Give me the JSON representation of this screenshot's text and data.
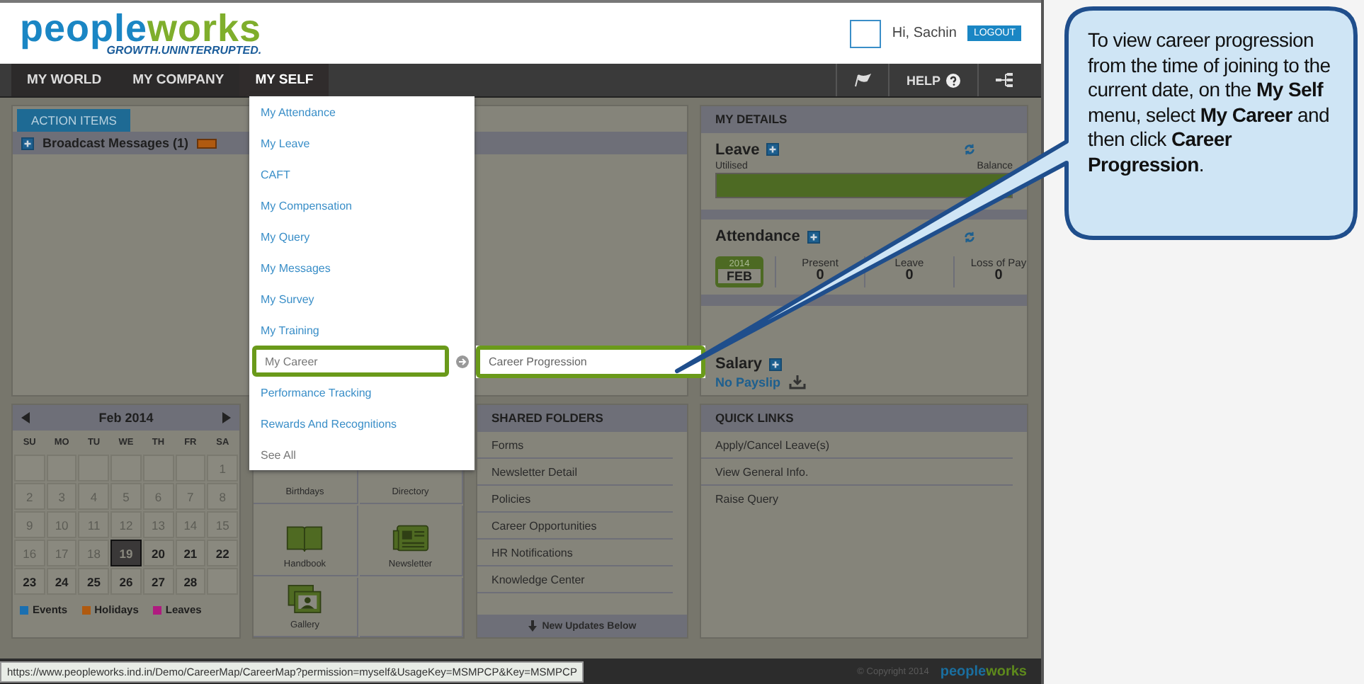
{
  "header": {
    "logo": {
      "part_1": "people",
      "part_2": "works",
      "tagline": "GROWTH.UNINTERRUPTED."
    },
    "greeting": "Hi, Sachin",
    "logout": "LOGOUT"
  },
  "nav": {
    "tabs": [
      {
        "label": "MY WORLD",
        "selected": false
      },
      {
        "label": "MY COMPANY",
        "selected": false
      },
      {
        "label": "MY SELF",
        "selected": true
      }
    ],
    "help": "HELP"
  },
  "action_items": {
    "tab": "ACTION ITEMS",
    "rows": [
      {
        "label": "Broadcast Messages (1)",
        "new": true
      }
    ]
  },
  "my_details": {
    "title": "MY DETAILS",
    "leave": {
      "title": "Leave",
      "left_label": "Utilised",
      "right_label": "Balance",
      "level": 1
    },
    "attendance": {
      "title": "Attendance",
      "year": "2014",
      "month": "FEB",
      "stats": [
        {
          "label": "Present",
          "value": "0"
        },
        {
          "label": "Leave",
          "value": "0"
        },
        {
          "label": "Loss of Pay",
          "value": "0"
        }
      ]
    },
    "salary": {
      "title": "Salary",
      "link": "No Payslip"
    }
  },
  "calendar": {
    "title": "Feb 2014",
    "weekdays": [
      "SU",
      "MO",
      "TU",
      "WE",
      "TH",
      "FR",
      "SA"
    ],
    "days": [
      {
        "kind": "blank"
      },
      {
        "kind": "blank"
      },
      {
        "kind": "blank"
      },
      {
        "kind": "blank"
      },
      {
        "kind": "blank"
      },
      {
        "kind": "blank"
      },
      {
        "kind": "day",
        "label": "1",
        "muted": true,
        "selected": false
      },
      {
        "kind": "day",
        "label": "2",
        "muted": true,
        "selected": false
      },
      {
        "kind": "day",
        "label": "3",
        "muted": true,
        "selected": false
      },
      {
        "kind": "day",
        "label": "4",
        "muted": true,
        "selected": false
      },
      {
        "kind": "day",
        "label": "5",
        "muted": true,
        "selected": false
      },
      {
        "kind": "day",
        "label": "6",
        "muted": true,
        "selected": false
      },
      {
        "kind": "day",
        "label": "7",
        "muted": true,
        "selected": false
      },
      {
        "kind": "day",
        "label": "8",
        "muted": true,
        "selected": false
      },
      {
        "kind": "day",
        "label": "9",
        "muted": true,
        "selected": false
      },
      {
        "kind": "day",
        "label": "10",
        "muted": true,
        "selected": false
      },
      {
        "kind": "day",
        "label": "11",
        "muted": true,
        "selected": false
      },
      {
        "kind": "day",
        "label": "12",
        "muted": true,
        "selected": false
      },
      {
        "kind": "day",
        "label": "13",
        "muted": true,
        "selected": false
      },
      {
        "kind": "day",
        "label": "14",
        "muted": true,
        "selected": false
      },
      {
        "kind": "day",
        "label": "15",
        "muted": true,
        "selected": false
      },
      {
        "kind": "day",
        "label": "16",
        "muted": true,
        "selected": false
      },
      {
        "kind": "day",
        "label": "17",
        "muted": true,
        "selected": false
      },
      {
        "kind": "day",
        "label": "18",
        "muted": true,
        "selected": false
      },
      {
        "kind": "day",
        "label": "19",
        "muted": false,
        "selected": true
      },
      {
        "kind": "day",
        "label": "20",
        "muted": false,
        "selected": false
      },
      {
        "kind": "day",
        "label": "21",
        "muted": false,
        "selected": false
      },
      {
        "kind": "day",
        "label": "22",
        "muted": false,
        "selected": false
      },
      {
        "kind": "day",
        "label": "23",
        "muted": false,
        "selected": false
      },
      {
        "kind": "day",
        "label": "24",
        "muted": false,
        "selected": false
      },
      {
        "kind": "day",
        "label": "25",
        "muted": false,
        "selected": false
      },
      {
        "kind": "day",
        "label": "26",
        "muted": false,
        "selected": false
      },
      {
        "kind": "day",
        "label": "27",
        "muted": false,
        "selected": false
      },
      {
        "kind": "day",
        "label": "28",
        "muted": false,
        "selected": false
      },
      {
        "kind": "blank"
      }
    ],
    "legend": [
      {
        "label": "Events",
        "color": "#1a6fb0"
      },
      {
        "label": "Holidays",
        "color": "#b05a10"
      },
      {
        "label": "Leaves",
        "color": "#b01a80"
      }
    ]
  },
  "tiles": [
    {
      "kind": "birthdays",
      "label": "Birthdays"
    },
    {
      "kind": "directory",
      "label": "Directory"
    },
    {
      "kind": "handbook",
      "label": "Handbook"
    },
    {
      "kind": "newsletter",
      "label": "Newsletter"
    },
    {
      "kind": "gallery",
      "label": "Gallery"
    },
    {
      "kind": "empty"
    }
  ],
  "shared_folders": {
    "title": "SHARED FOLDERS",
    "items": [
      "Forms",
      "Newsletter Detail",
      "Policies",
      "Career Opportunities",
      "HR Notifications",
      "Knowledge Center"
    ],
    "footer": "New Updates Below"
  },
  "quick_links": {
    "title": "QUICK LINKS",
    "items": [
      "Apply/Cancel Leave(s)",
      "View General Info.",
      "Raise Query"
    ]
  },
  "menu": {
    "items": [
      {
        "label": "My Attendance",
        "kind": "link",
        "selected": false,
        "has_submenu": false
      },
      {
        "label": "My Leave",
        "kind": "link",
        "selected": false,
        "has_submenu": false
      },
      {
        "label": "CAFT",
        "kind": "link",
        "selected": false,
        "has_submenu": false
      },
      {
        "label": "My Compensation",
        "kind": "link",
        "selected": false,
        "has_submenu": false
      },
      {
        "label": "My Query",
        "kind": "link",
        "selected": false,
        "has_submenu": false
      },
      {
        "label": "My Messages",
        "kind": "link",
        "selected": false,
        "has_submenu": false
      },
      {
        "label": "My Survey",
        "kind": "link",
        "selected": false,
        "has_submenu": false
      },
      {
        "label": "My Training",
        "kind": "link",
        "selected": false,
        "has_submenu": false
      },
      {
        "label": "My Career",
        "kind": "link",
        "selected": true,
        "has_submenu": true
      },
      {
        "label": "Performance Tracking",
        "kind": "link",
        "selected": false,
        "has_submenu": false
      },
      {
        "label": "Rewards And Recognitions",
        "kind": "link",
        "selected": false,
        "has_submenu": false
      },
      {
        "label": "See All",
        "kind": "more",
        "selected": false,
        "has_submenu": false
      }
    ]
  },
  "submenu": {
    "items": [
      {
        "label": "Career Progression",
        "selected": true
      }
    ]
  },
  "status_bar": {
    "url": "https://www.peopleworks.ind.in/Demo/CareerMap/CareerMap?permission=myself&UsageKey=MSMPCP&Key=MSMPCP",
    "copyright": "© Copyright 2014",
    "logo": {
      "part_1": "people",
      "part_2": "works"
    }
  },
  "callout": {
    "text": "To view career progression from the time of joining to the current date, on the **My Self** menu, select **My Career** and then click **Career Progression**."
  }
}
